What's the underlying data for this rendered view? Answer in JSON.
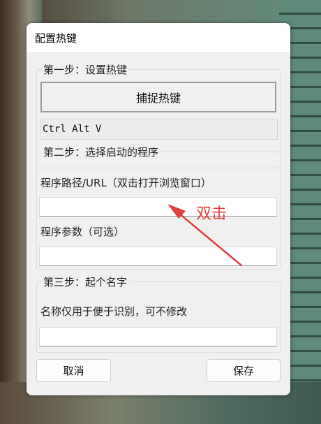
{
  "window": {
    "title": "配置热键"
  },
  "step1": {
    "legend": "第一步：设置热键",
    "capture_button_label": "捕捉热键",
    "current_hotkey": "Ctrl Alt V"
  },
  "step2": {
    "legend": "第二步：选择启动的程序",
    "path_label": "程序路径/URL（双击打开浏览窗口）",
    "path_value": "",
    "args_label": "程序参数（可选）",
    "args_value": ""
  },
  "step3": {
    "legend": "第三步：起个名字",
    "name_label": "名称仅用于便于识别，可不修改",
    "name_value": ""
  },
  "buttons": {
    "cancel": "取消",
    "save": "保存"
  },
  "annotation": {
    "text": "双击",
    "color": "#e2403a"
  }
}
